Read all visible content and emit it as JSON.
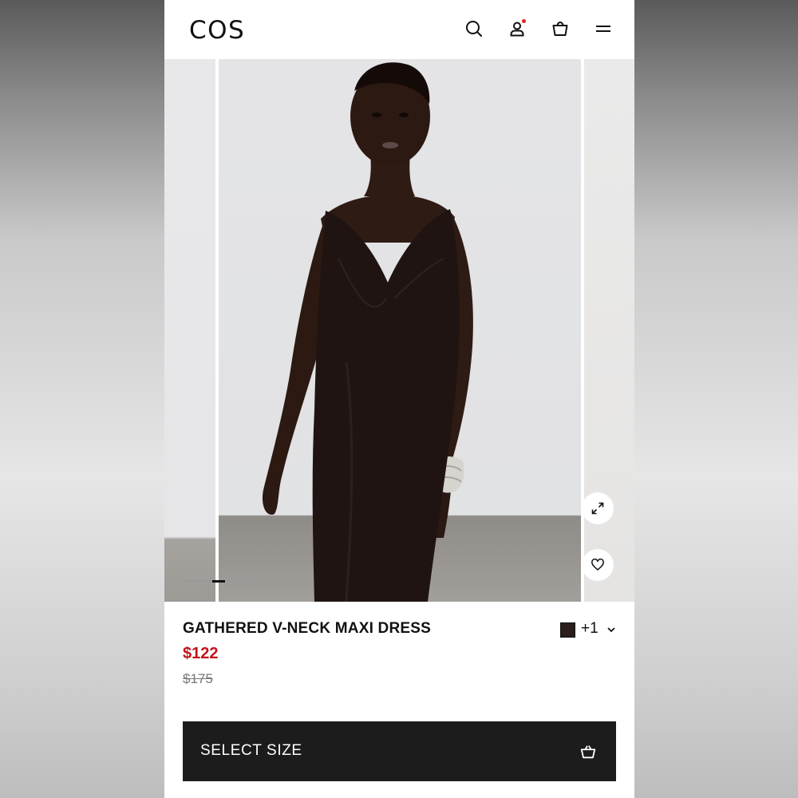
{
  "header": {
    "logo": "COS",
    "icons": [
      "search-icon",
      "account-icon",
      "bag-icon",
      "menu-icon"
    ],
    "account_notification_color": "#e0261f"
  },
  "gallery": {
    "progress": {
      "current_fraction": 0.5
    },
    "actions": [
      "expand-icon",
      "heart-icon"
    ]
  },
  "product": {
    "title": "GATHERED V-NECK MAXI DRESS",
    "sale_price": "$122",
    "original_price": "$175",
    "sale_color": "#c3121c",
    "color_swatch": "#2a1d1b",
    "more_colors": "+1"
  },
  "cta": {
    "label": "SELECT SIZE"
  }
}
